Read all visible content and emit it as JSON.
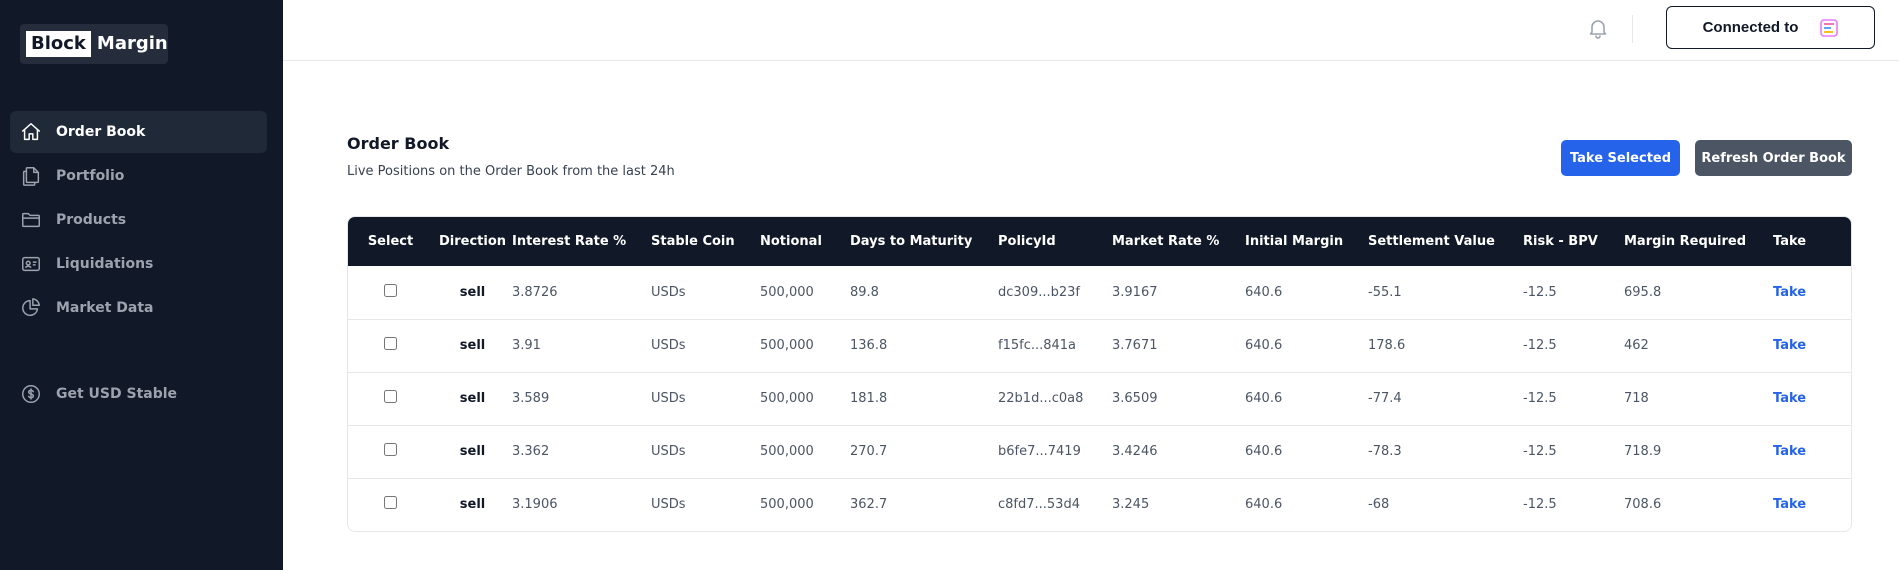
{
  "logo": {
    "part1": "Block",
    "part2": "Margin"
  },
  "sidebar": {
    "items": [
      {
        "label": "Order Book",
        "icon": "home-icon",
        "active": true
      },
      {
        "label": "Portfolio",
        "icon": "documents-icon",
        "active": false
      },
      {
        "label": "Products",
        "icon": "folder-icon",
        "active": false
      },
      {
        "label": "Liquidations",
        "icon": "id-card-icon",
        "active": false
      },
      {
        "label": "Market Data",
        "icon": "pie-chart-icon",
        "active": false
      }
    ],
    "extra_item": {
      "label": "Get USD Stable",
      "icon": "dollar-circle-icon"
    }
  },
  "header": {
    "connect_label": "Connected to",
    "wallet_icon": "wallet-logo-icon",
    "bell_icon": "bell-icon"
  },
  "main": {
    "title": "Order Book",
    "subtitle": "Live Positions on the Order Book from the last 24h",
    "take_selected_label": "Take Selected",
    "refresh_label": "Refresh Order Book"
  },
  "table": {
    "columns": [
      "Select",
      "Direction",
      "Interest Rate %",
      "Stable Coin",
      "Notional",
      "Days to Maturity",
      "PolicyId",
      "Market Rate %",
      "Initial Margin",
      "Settlement Value",
      "Risk - BPV",
      "Margin Required",
      "Take"
    ],
    "rows": [
      {
        "direction": "sell",
        "interest_rate": "3.8726",
        "stable_coin": "USDs",
        "notional": "500,000",
        "days_to_maturity": "89.8",
        "policy_id": "dc309...b23f",
        "market_rate": "3.9167",
        "initial_margin": "640.6",
        "settlement_value": "-55.1",
        "risk_bpv": "-12.5",
        "margin_required": "695.8",
        "take": "Take"
      },
      {
        "direction": "sell",
        "interest_rate": "3.91",
        "stable_coin": "USDs",
        "notional": "500,000",
        "days_to_maturity": "136.8",
        "policy_id": "f15fc...841a",
        "market_rate": "3.7671",
        "initial_margin": "640.6",
        "settlement_value": "178.6",
        "risk_bpv": "-12.5",
        "margin_required": "462",
        "take": "Take"
      },
      {
        "direction": "sell",
        "interest_rate": "3.589",
        "stable_coin": "USDs",
        "notional": "500,000",
        "days_to_maturity": "181.8",
        "policy_id": "22b1d...c0a8",
        "market_rate": "3.6509",
        "initial_margin": "640.6",
        "settlement_value": "-77.4",
        "risk_bpv": "-12.5",
        "margin_required": "718",
        "take": "Take"
      },
      {
        "direction": "sell",
        "interest_rate": "3.362",
        "stable_coin": "USDs",
        "notional": "500,000",
        "days_to_maturity": "270.7",
        "policy_id": "b6fe7...7419",
        "market_rate": "3.4246",
        "initial_margin": "640.6",
        "settlement_value": "-78.3",
        "risk_bpv": "-12.5",
        "margin_required": "718.9",
        "take": "Take"
      },
      {
        "direction": "sell",
        "interest_rate": "3.1906",
        "stable_coin": "USDs",
        "notional": "500,000",
        "days_to_maturity": "362.7",
        "policy_id": "c8fd7...53d4",
        "market_rate": "3.245",
        "initial_margin": "640.6",
        "settlement_value": "-68",
        "risk_bpv": "-12.5",
        "margin_required": "708.6",
        "take": "Take"
      }
    ]
  },
  "colors": {
    "sidebar_bg": "#111827",
    "primary": "#2563eb",
    "secondary_button": "#4b5563"
  }
}
